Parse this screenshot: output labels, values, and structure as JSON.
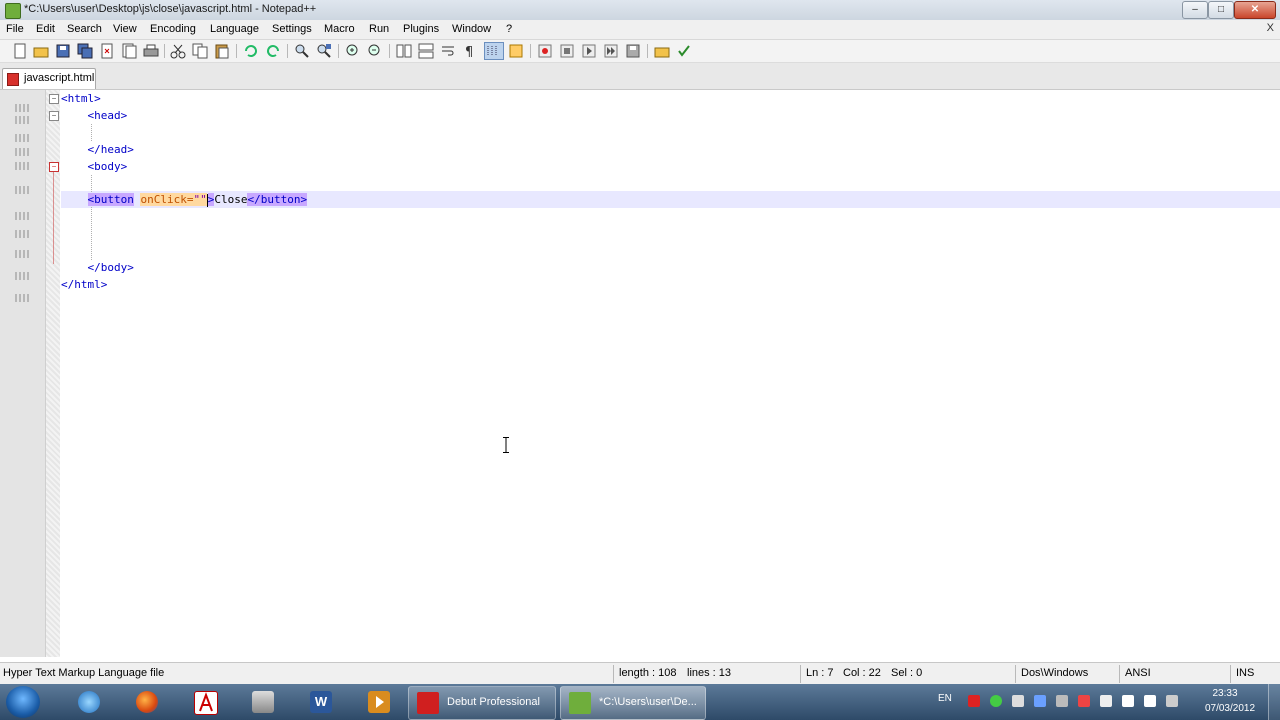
{
  "window": {
    "title": "*C:\\Users\\user\\Desktop\\js\\close\\javascript.html - Notepad++",
    "buttons": {
      "minimize": "–",
      "maximize": "□",
      "close": "✕"
    }
  },
  "menu": {
    "items": [
      "File",
      "Edit",
      "Search",
      "View",
      "Encoding",
      "Language",
      "Settings",
      "Macro",
      "Run",
      "Plugins",
      "Window",
      "?"
    ],
    "close_glyph": "X"
  },
  "toolbar": {
    "icons": [
      "new-file-icon",
      "open-file-icon",
      "save-icon",
      "save-all-icon",
      "close-icon",
      "close-all-icon",
      "print-icon",
      "cut-icon",
      "copy-icon",
      "paste-icon",
      "undo-icon",
      "redo-icon",
      "find-icon",
      "replace-icon",
      "zoom-in-icon",
      "zoom-out-icon",
      "sync-v-icon",
      "sync-h-icon",
      "word-wrap-icon",
      "all-chars-icon",
      "indent-guide-icon",
      "user-lang-icon",
      "doc-map-icon",
      "record-macro-icon",
      "stop-record-icon",
      "play-macro-icon",
      "run-macro-multiple-icon",
      "save-macro-icon",
      "folder-icon",
      "spellcheck-icon"
    ]
  },
  "tabs": [
    {
      "label": "javascript.html",
      "active": true
    }
  ],
  "editor": {
    "lines": [
      {
        "indent": "",
        "content": "<html>"
      },
      {
        "indent": "    ",
        "content": "<head>"
      },
      {
        "indent": "",
        "content": ""
      },
      {
        "indent": "    ",
        "content": "</head>"
      },
      {
        "indent": "    ",
        "content": "<body>"
      },
      {
        "indent": "",
        "content": ""
      },
      {
        "indent": "    ",
        "tag_open": "<button",
        "attr": "onClick=",
        "str": "\"\"",
        "close_bracket": ">",
        "text": "Close",
        "tag_close": "</button>"
      },
      {
        "indent": "",
        "content": ""
      },
      {
        "indent": "",
        "content": ""
      },
      {
        "indent": "",
        "content": ""
      },
      {
        "indent": "    ",
        "content": "</body>"
      },
      {
        "indent": "",
        "content": "</html>"
      }
    ]
  },
  "status": {
    "file_type": "Hyper Text Markup Language file",
    "length": "length : 108",
    "lines": "lines : 13",
    "ln": "Ln : 7",
    "col": "Col : 22",
    "sel": "Sel : 0",
    "eol": "Dos\\Windows",
    "encoding": "ANSI",
    "mode": "INS"
  },
  "taskbar": {
    "pinned": [
      "internet-explorer-icon",
      "firefox-icon",
      "acrobat-icon",
      "scanner-icon",
      "word-icon",
      "media-player-icon"
    ],
    "tasks": [
      {
        "label": "Debut Professional",
        "icon": "debut-icon"
      },
      {
        "label": "*C:\\Users\\user\\De...",
        "icon": "notepadpp-icon"
      }
    ],
    "language": "EN",
    "clock_time": "23:33",
    "clock_date": "07/03/2012"
  }
}
